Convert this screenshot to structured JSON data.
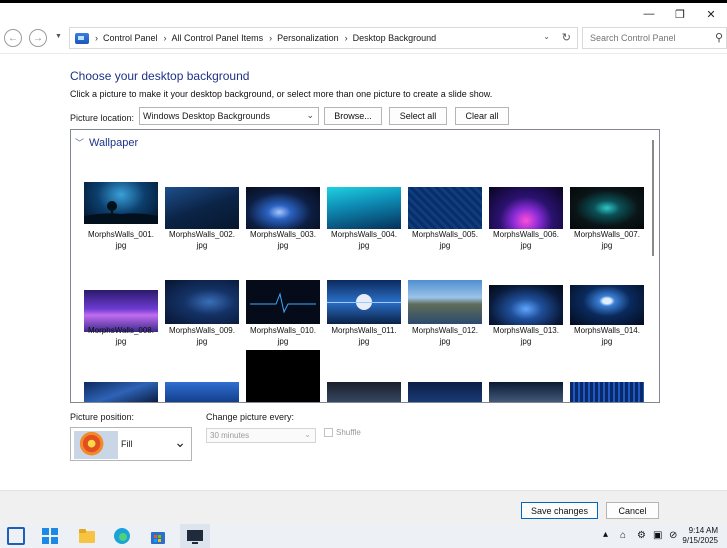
{
  "window": {
    "minimize": "—",
    "maximize": "❐",
    "close": "✕"
  },
  "nav": {
    "back_icon": "back-arrow-icon",
    "forward_icon": "forward-arrow-icon",
    "recent_icon": "chevron-down-icon",
    "breadcrumbs": [
      "Control Panel",
      "All Control Panel Items",
      "Personalization",
      "Desktop Background"
    ],
    "separator": "›",
    "refresh_icon": "refresh-icon",
    "search_placeholder": "Search Control Panel"
  },
  "page": {
    "title": "Choose your desktop background",
    "instruction": "Click a picture to make it your desktop background, or select more than one picture to create a slide show.",
    "picture_location_label": "Picture location:",
    "picture_location_value": "Windows Desktop Backgrounds",
    "browse_label": "Browse...",
    "select_all_label": "Select all",
    "clear_all_label": "Clear all"
  },
  "gallery": {
    "group_name": "Wallpaper",
    "items": [
      {
        "name": "MorphsWalls_001.",
        "ext": "jpg"
      },
      {
        "name": "MorphsWalls_002.",
        "ext": "jpg"
      },
      {
        "name": "MorphsWalls_003.",
        "ext": "jpg"
      },
      {
        "name": "MorphsWalls_004.",
        "ext": "jpg"
      },
      {
        "name": "MorphsWalls_005.",
        "ext": "jpg"
      },
      {
        "name": "MorphsWalls_006.",
        "ext": "jpg"
      },
      {
        "name": "MorphsWalls_007.",
        "ext": "jpg"
      },
      {
        "name": "MorphsWalls_008.",
        "ext": "jpg"
      },
      {
        "name": "MorphsWalls_009.",
        "ext": "jpg"
      },
      {
        "name": "MorphsWalls_010.",
        "ext": "jpg"
      },
      {
        "name": "MorphsWalls_011.",
        "ext": "jpg"
      },
      {
        "name": "MorphsWalls_012.",
        "ext": "jpg"
      },
      {
        "name": "MorphsWalls_013.",
        "ext": "jpg"
      },
      {
        "name": "MorphsWalls_014.",
        "ext": "jpg"
      }
    ]
  },
  "position": {
    "label": "Picture position:",
    "value": "Fill"
  },
  "slideshow": {
    "change_label": "Change picture every:",
    "interval": "30 minutes",
    "shuffle_label": "Shuffle"
  },
  "footer": {
    "save_label": "Save changes",
    "cancel_label": "Cancel"
  },
  "taskbar": {
    "time": "9:14 AM",
    "date": "9/15/2025"
  }
}
